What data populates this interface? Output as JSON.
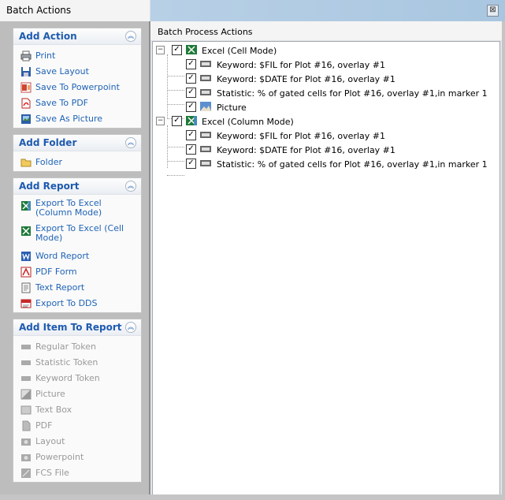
{
  "window": {
    "title": "Batch Actions",
    "close": "⊠"
  },
  "groups": {
    "add_action": {
      "title": "Add Action",
      "items": [
        "Print",
        "Save Layout",
        "Save To Powerpoint",
        "Save To PDF",
        "Save As Picture"
      ]
    },
    "add_folder": {
      "title": "Add Folder",
      "items": [
        "Folder"
      ]
    },
    "add_report": {
      "title": "Add Report",
      "items": [
        "Export To Excel (Column Mode)",
        "Export To Excel (Cell Mode)",
        "Word Report",
        "PDF Form",
        "Text Report",
        "Export To DDS"
      ]
    },
    "add_item": {
      "title": "Add Item To Report",
      "items": [
        "Regular Token",
        "Statistic Token",
        "Keyword Token",
        "Picture",
        "Text Box",
        "PDF",
        "Layout",
        "Powerpoint",
        "FCS File"
      ]
    }
  },
  "panel": {
    "title": "Batch Process Actions"
  },
  "tree": {
    "node1": {
      "label": "Excel (Cell Mode)",
      "children": [
        "Keyword: $FIL for Plot #16, overlay #1",
        "Keyword: $DATE for Plot #16, overlay #1",
        "Statistic: % of gated cells for Plot #16, overlay #1,in marker 1",
        "Picture"
      ]
    },
    "node2": {
      "label": "Excel (Column Mode)",
      "children": [
        "Keyword: $FIL for Plot #16, overlay #1",
        "Keyword: $DATE for Plot #16, overlay #1",
        "Statistic: % of gated cells for Plot #16, overlay #1,in marker 1"
      ]
    }
  },
  "glyphs": {
    "check": "✓",
    "collapse": "−",
    "chevron": "︽"
  }
}
